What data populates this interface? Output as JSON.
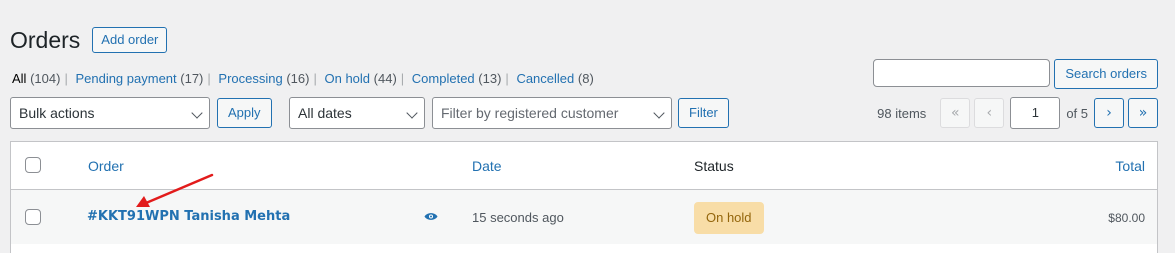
{
  "header": {
    "title": "Orders",
    "add_button": "Add order"
  },
  "views": [
    {
      "label": "All",
      "count": "(104)",
      "current": true
    },
    {
      "label": "Pending payment",
      "count": "(17)"
    },
    {
      "label": "Processing",
      "count": "(16)"
    },
    {
      "label": "On hold",
      "count": "(44)"
    },
    {
      "label": "Completed",
      "count": "(13)"
    },
    {
      "label": "Cancelled",
      "count": "(8)"
    }
  ],
  "search": {
    "value": "",
    "button": "Search orders"
  },
  "filters": {
    "bulk_actions": "Bulk actions",
    "apply": "Apply",
    "dates": "All dates",
    "customer_placeholder": "Filter by registered customer",
    "filter": "Filter"
  },
  "pagination": {
    "items": "98 items",
    "first": "«",
    "prev": "‹",
    "current_page": "1",
    "of": "of 5",
    "next": "›",
    "last": "»"
  },
  "table": {
    "columns": {
      "order": "Order",
      "date": "Date",
      "status": "Status",
      "total": "Total"
    },
    "rows": [
      {
        "order": "#KKT91WPN Tanisha Mehta",
        "date": "15 seconds ago",
        "status": "On hold",
        "total": "$80.00"
      }
    ]
  },
  "icons": {
    "preview": "eye-icon",
    "annotation": "red-arrow-icon"
  },
  "colors": {
    "link": "#2271b1",
    "status_on_hold_bg": "#f8dda7",
    "status_on_hold_text": "#94660c",
    "annotation": "#e21b1b"
  }
}
